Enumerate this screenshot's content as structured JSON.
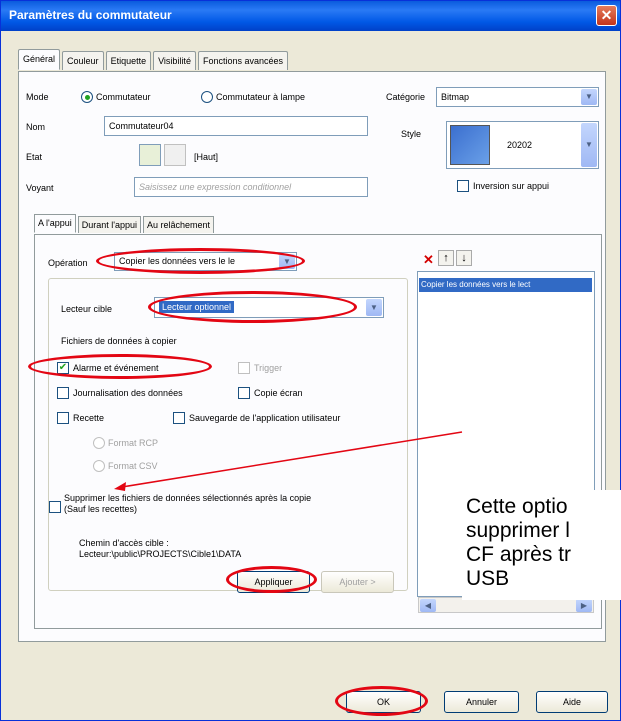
{
  "window": {
    "title": "Paramètres du commutateur",
    "close_glyph": "✕"
  },
  "tabs": [
    "Général",
    "Couleur",
    "Etiquette",
    "Visibilité",
    "Fonctions avancées"
  ],
  "general": {
    "mode_label": "Mode",
    "mode_option1": "Commutateur",
    "mode_option2": "Commutateur à lampe",
    "categorie_label": "Catégorie",
    "categorie_value": "Bitmap",
    "nom_label": "Nom",
    "nom_value": "Commutateur04",
    "style_label": "Style",
    "style_value": "20202",
    "etat_label": "Etat",
    "etat_value": "[Haut]",
    "voyant_label": "Voyant",
    "voyant_placeholder": "Saisissez une expression conditionnel",
    "inversion_label": "Inversion sur appui"
  },
  "subtabs": [
    "A l'appui",
    "Durant l'appui",
    "Au relâchement"
  ],
  "action": {
    "operation_label": "Opération",
    "operation_value": "Copier les données vers le le",
    "lecteur_label": "Lecteur cible",
    "lecteur_value": "Lecteur optionnel",
    "fichiers_label": "Fichiers de données à copier",
    "chk_alarme": "Alarme et événement",
    "chk_alarme_checkmark": "✔",
    "chk_trigger": "Trigger",
    "chk_journal": "Journalisation des données",
    "chk_copie": "Copie écran",
    "chk_recette": "Recette",
    "chk_sauvegarde": "Sauvegarde de l'application utilisateur",
    "radio_rcp": "Format RCP",
    "radio_csv": "Format CSV",
    "supprimer_line1": "Supprimer les fichiers de données sélectionnés après la copie",
    "supprimer_line2": "(Sauf les recettes)",
    "chemin_label": "Chemin d'accès cible :",
    "chemin_value": "Lecteur:\\public\\PROJECTS\\Cible1\\DATA",
    "appliquer": "Appliquer",
    "ajouter": "Ajouter >"
  },
  "list": {
    "delete_icon": "✕",
    "up_icon": "↑",
    "down_icon": "↓",
    "item": "Copier les données vers le lect"
  },
  "footer": {
    "ok": "OK",
    "annuler": "Annuler",
    "aide": "Aide"
  },
  "annotation": {
    "line1": "Cette optio",
    "line2": "supprimer l",
    "line3": "CF après tr",
    "line4": "USB"
  },
  "colors": {
    "highlight_ellipse": "#e30613",
    "selection": "#316ac5",
    "title_bar": "#0058e6"
  }
}
